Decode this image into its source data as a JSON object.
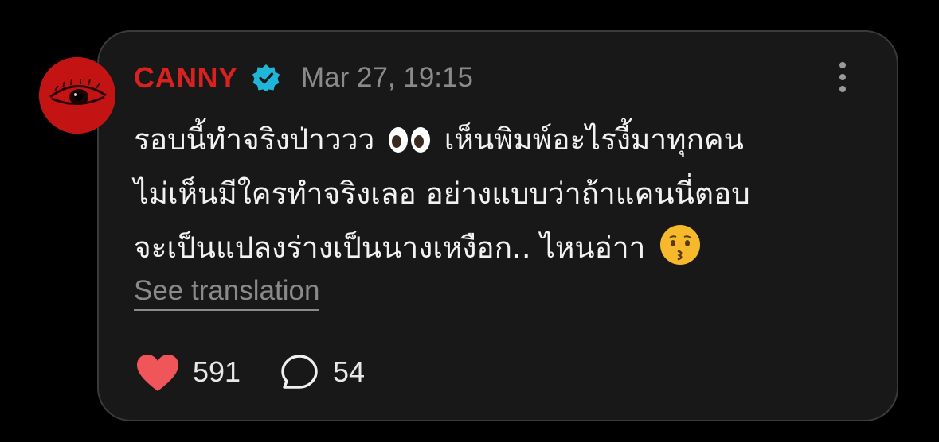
{
  "post": {
    "author": "CANNY",
    "verified": true,
    "timestamp": "Mar 27, 19:15",
    "text_lines": [
      "รอบนี้ทำจริงป่าววว",
      "เห็นพิมพ์อะไรงี้มาทุกคน",
      "ไม่เห็นมีใครทำจริงเลอ อย่างแบบว่าถ้าแคนนี่ตอบ",
      "จะเป็นแปลงร่างเป็นนางเหงือก.. ไหนอ่าา"
    ],
    "emojis": [
      "eyes",
      "kissing-face"
    ],
    "see_translation": "See translation"
  },
  "stats": {
    "likes": "591",
    "replies": "54"
  },
  "icons": {
    "like": "heart-icon",
    "reply": "speech-bubble-icon",
    "more": "more-vertical-icon",
    "verified": "verified-badge-icon"
  },
  "colors": {
    "author": "#d7221f",
    "verified_badge": "#1fb6d9",
    "heart": "#f0555a",
    "card_bg": "#181818",
    "page_bg": "#000000"
  }
}
